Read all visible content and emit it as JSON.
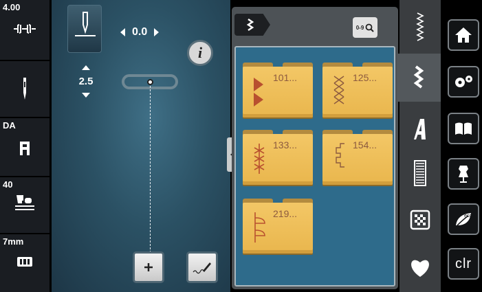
{
  "status": {
    "tension_value": "4.00",
    "needle_value": "",
    "foot_value": "DA",
    "pressure_value": "40",
    "width_value": "7mm"
  },
  "stitch": {
    "width_value": "0.0",
    "length_value": "2.5"
  },
  "panel": {
    "num_search_label": "0-9",
    "folders": [
      {
        "label": "101...",
        "icon": "triangle-stitch-icon"
      },
      {
        "label": "125...",
        "icon": "cross-stitch-icon"
      },
      {
        "label": "133...",
        "icon": "star-stitch-icon"
      },
      {
        "label": "154...",
        "icon": "step-stitch-icon"
      },
      {
        "label": "219...",
        "icon": "leaf-stitch-icon"
      }
    ]
  },
  "side": {
    "clr_label": "clr"
  },
  "colors": {
    "folder": "#f0c25f",
    "folder_text": "#8c5a3f",
    "panel_bg": "#2e6b8b",
    "stitch_bg": "#2b5164"
  }
}
